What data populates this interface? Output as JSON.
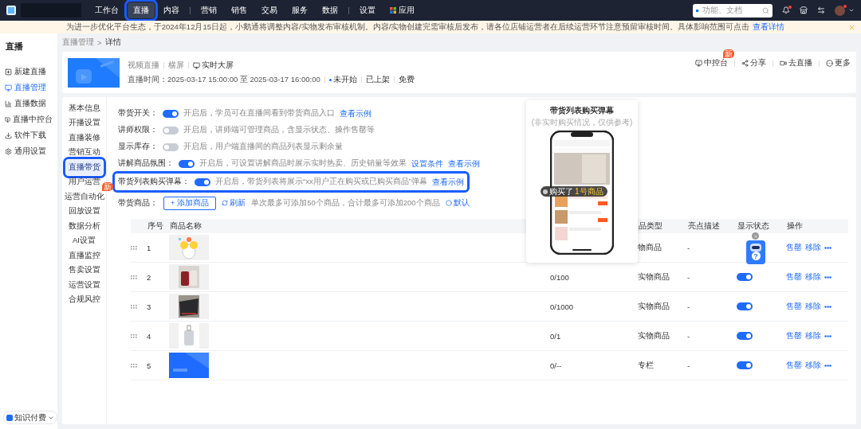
{
  "top_nav": {
    "items": [
      {
        "label": "工作台",
        "kind": "tab",
        "selected": false,
        "highlighted": false,
        "divider_before": false
      },
      {
        "label": "直播",
        "kind": "tab",
        "selected": true,
        "highlighted": true,
        "divider_before": false
      },
      {
        "label": "内容",
        "kind": "tab",
        "selected": false,
        "highlighted": false,
        "divider_before": false
      },
      {
        "label": "营销",
        "kind": "tab",
        "selected": false,
        "highlighted": false,
        "divider_before": true
      },
      {
        "label": "销售",
        "kind": "tab",
        "selected": false,
        "highlighted": false,
        "divider_before": false
      },
      {
        "label": "交易",
        "kind": "tab",
        "selected": false,
        "highlighted": false,
        "divider_before": false
      },
      {
        "label": "服务",
        "kind": "tab",
        "selected": false,
        "highlighted": false,
        "divider_before": false
      },
      {
        "label": "数据",
        "kind": "tab",
        "selected": false,
        "highlighted": false,
        "divider_before": false
      },
      {
        "label": "设置",
        "kind": "tab",
        "selected": false,
        "highlighted": false,
        "divider_before": true
      },
      {
        "label": "应用",
        "kind": "apps",
        "selected": false,
        "highlighted": false,
        "divider_before": false
      }
    ],
    "search": {
      "placeholder": "功能、文档"
    },
    "bell_unread": true,
    "avatar_unread": true
  },
  "notice": {
    "text": "为进一步优化平台生态，于2024年12月15日起，小鹅通将调整内容/实物发布审核机制。内容/实物创建完需审核后发布，请各位店铺运营者在后续运营环节注意预留审核时间。具体影响范围可点击",
    "link": "查看详情"
  },
  "sidebar": {
    "title": "直播",
    "items": [
      {
        "label": "新建直播",
        "selected": false
      },
      {
        "label": "直播管理",
        "selected": true
      },
      {
        "label": "直播数据",
        "selected": false
      },
      {
        "label": "直播中控台",
        "selected": false
      },
      {
        "label": "软件下载",
        "selected": false
      },
      {
        "label": "通用设置",
        "selected": false
      }
    ],
    "footer": "知识付费"
  },
  "breadcrumb": {
    "items": [
      "直播管理",
      "详情"
    ],
    "separator": ">"
  },
  "live": {
    "tags": [
      "视频直播",
      "横屏"
    ],
    "screen_link": "实时大屏",
    "time_label": "直播时间：",
    "time": "2025-03-17 15:00:00 至 2025-03-17 16:00:00",
    "status": "未开始",
    "listing": "已上架",
    "price": "免费",
    "actions": [
      {
        "label": "中控台",
        "badge": "新"
      },
      {
        "label": "分享"
      },
      {
        "label": "去直播"
      },
      {
        "label": "更多"
      }
    ]
  },
  "subnav": [
    {
      "label": "基本信息",
      "selected": false,
      "highlighted": false
    },
    {
      "label": "开播设置",
      "selected": false,
      "highlighted": false
    },
    {
      "label": "直播装修",
      "selected": false,
      "highlighted": false
    },
    {
      "label": "营销互动",
      "selected": false,
      "highlighted": false
    },
    {
      "label": "直播带货",
      "selected": true,
      "highlighted": true
    },
    {
      "label": "用户运营",
      "selected": false,
      "highlighted": false
    },
    {
      "label": "运营自动化",
      "selected": false,
      "highlighted": false,
      "badge": "新"
    },
    {
      "label": "回放设置",
      "selected": false,
      "highlighted": false
    },
    {
      "label": "数据分析",
      "selected": false,
      "highlighted": false
    },
    {
      "label": "AI设置",
      "selected": false,
      "highlighted": false
    },
    {
      "label": "直播监控",
      "selected": false,
      "highlighted": false
    },
    {
      "label": "售卖设置",
      "selected": false,
      "highlighted": false
    },
    {
      "label": "运营设置",
      "selected": false,
      "highlighted": false
    },
    {
      "label": "合规风控",
      "selected": false,
      "highlighted": false
    }
  ],
  "settings": [
    {
      "label": "带货开关：",
      "on": true,
      "highlighted": false,
      "description": "开启后，学员可在直播间看到带货商品入口",
      "links": [
        "查看示例"
      ]
    },
    {
      "label": "讲师权限：",
      "on": false,
      "highlighted": false,
      "description": "开启后，讲师端可管理商品，含显示状态、操作售罄等"
    },
    {
      "label": "显示库存：",
      "on": false,
      "highlighted": false,
      "description": "开启后，用户端直播间的商品列表显示剩余量"
    },
    {
      "label": "讲解商品氛围：",
      "on": true,
      "highlighted": false,
      "description": "开启后，可设置讲解商品时展示实时热卖、历史销量等效果",
      "links": [
        "设置条件",
        "查看示例"
      ]
    },
    {
      "label": "带货列表购买弹幕：",
      "on": true,
      "highlighted": true,
      "description": "开启后，带货列表将展示“xx用户正在购买或已购买商品”弹幕",
      "links": [
        "查看示例"
      ]
    }
  ],
  "goods_row": {
    "label": "带货商品：",
    "add_button": "+ 添加商品",
    "refresh": "刷新",
    "hint": "单次最多可添加50个商品，合计最多可添加200个商品",
    "default_link": "默认"
  },
  "table": {
    "columns": [
      "序号",
      "商品名称",
      "品类型",
      "亮点描述",
      "显示状态",
      "操作"
    ],
    "rows": [
      {
        "index": "1",
        "type": "物商品",
        "highlight": "-",
        "actions": [
          "售罄",
          "移除"
        ]
      },
      {
        "index": "2",
        "stock": "0/100",
        "type": "实物商品",
        "highlight": "-",
        "visible": true,
        "actions": [
          "售罄",
          "移除"
        ]
      },
      {
        "index": "3",
        "stock": "0/1000",
        "type": "实物商品",
        "highlight": "-",
        "visible": true,
        "actions": [
          "售罄",
          "移除"
        ]
      },
      {
        "index": "4",
        "stock": "0/1",
        "type": "实物商品",
        "highlight": "-",
        "visible": true,
        "actions": [
          "售罄",
          "移除"
        ]
      },
      {
        "index": "5",
        "stock": "0/--",
        "type": "专栏",
        "highlight": "-",
        "visible": true,
        "actions": [
          "售罄",
          "移除"
        ]
      }
    ]
  },
  "preview": {
    "title": "带货列表购买弹幕",
    "subtitle": "(非实时购买情况，仅供参考)",
    "toast_prefix": "购买了",
    "toast_product": "1号商品"
  },
  "help_widget": {
    "label": "?"
  }
}
